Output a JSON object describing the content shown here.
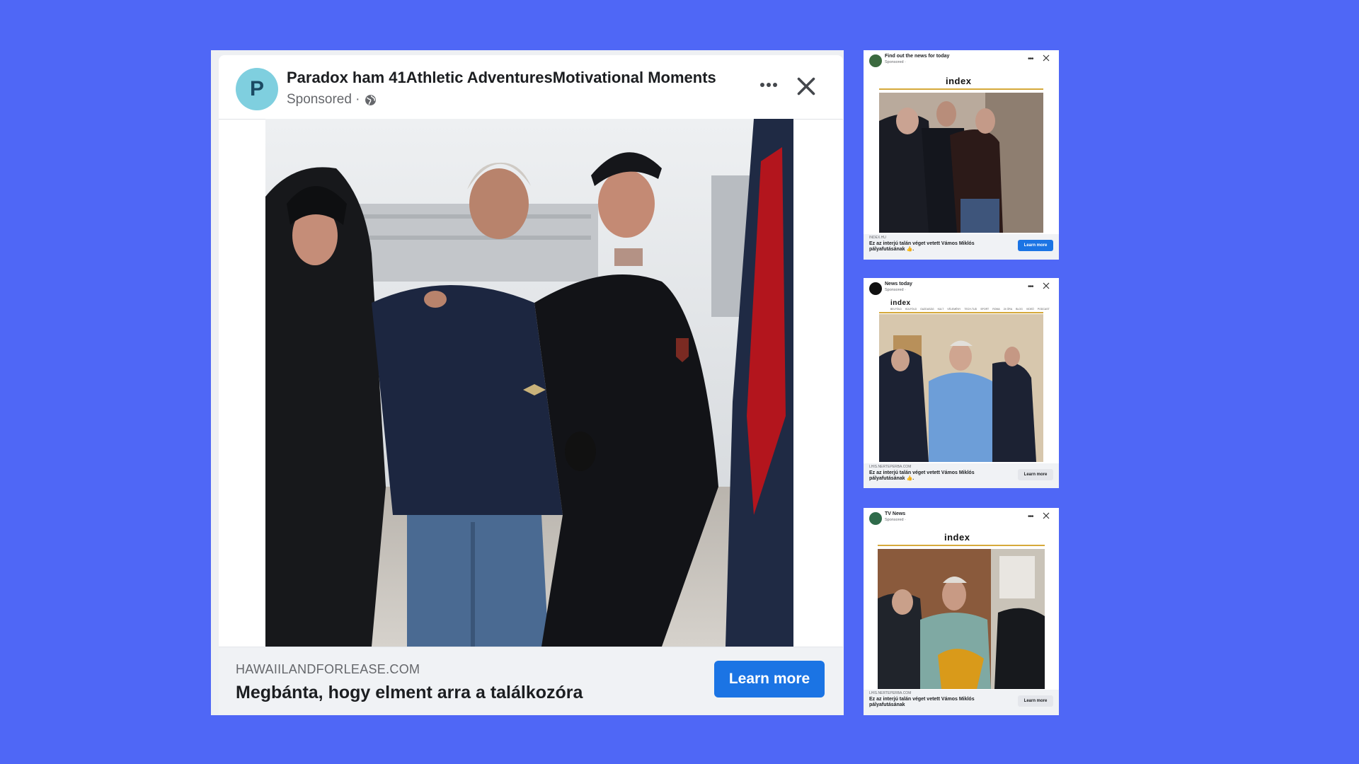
{
  "main_ad": {
    "avatar_letter": "P",
    "page_name": "Paradox ham 41Athletic AdventuresMotivational Moments",
    "sponsored": "Sponsored ·",
    "more_icon": "more-horizontal-icon",
    "close_icon": "close-icon",
    "domain": "HAWAIILANDFORLEASE.COM",
    "headline": "Megbánta, hogy elment arra a találkozóra",
    "cta": "Learn more"
  },
  "small_ads": [
    {
      "page_name": "Find out the news for today",
      "sponsored": "Sponsored ·",
      "logo": "index",
      "domain": "INDEX.HU",
      "text": "Ez az interjú talán véget vetett Vámos Miklós pályafutásának 👍.",
      "cta": "Learn more",
      "accent": "#1b74e4"
    },
    {
      "page_name": "News today",
      "sponsored": "Sponsored ·",
      "logo": "index",
      "menu": [
        "BELFÖLD",
        "KÜLFÖLD",
        "GAZDASÁG",
        "KULT",
        "VÉLEMÉNY",
        "TECH-TUD",
        "SPORT",
        "ROMA",
        "24 ÓRA",
        "BLOG",
        "VIDEÓ",
        "PODCAST"
      ],
      "domain": "LHIS.NERTEPERBA.COM",
      "text": "Ez az interjú talán véget vetett Vámos Miklós pályafutásának 👍.",
      "cta": "Learn more"
    },
    {
      "page_name": "TV News",
      "sponsored": "Sponsored ·",
      "logo": "index",
      "domain": "LHIS.NERTEPERBA.COM",
      "text": "Ez az interjú talán véget vetett Vámos Miklós pályafutásának",
      "cta": "Learn more"
    }
  ],
  "colors": {
    "background": "#4f67f6",
    "cta_blue": "#1b74e4",
    "avatar_teal": "#7fcfdf"
  }
}
